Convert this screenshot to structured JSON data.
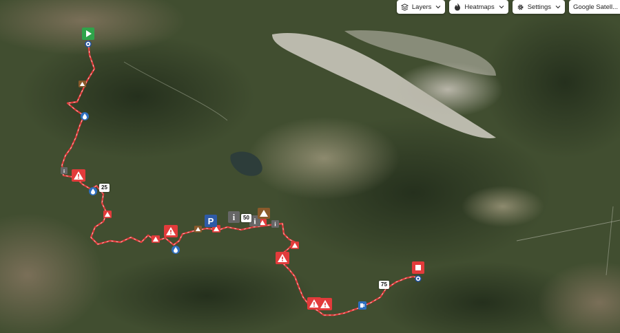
{
  "toolbar": {
    "layers_label": "Layers",
    "heatmaps_label": "Heatmaps",
    "settings_label": "Settings",
    "basemap_label": "Google Satell..."
  },
  "route": {
    "color": "#e23b3b",
    "km_markers": [
      "25",
      "50",
      "75"
    ]
  },
  "markers": [
    {
      "type": "start",
      "icon": "play-icon"
    },
    {
      "type": "finish",
      "icon": "stop-icon"
    },
    {
      "type": "parking",
      "label": "P",
      "icon": "parking-icon"
    },
    {
      "type": "info",
      "label": "i",
      "icon": "info-icon"
    },
    {
      "type": "warning",
      "icon": "warning-icon"
    },
    {
      "type": "water",
      "icon": "water-drop-icon"
    },
    {
      "type": "camping",
      "icon": "tent-icon"
    },
    {
      "type": "fuel",
      "icon": "fuel-icon"
    }
  ]
}
